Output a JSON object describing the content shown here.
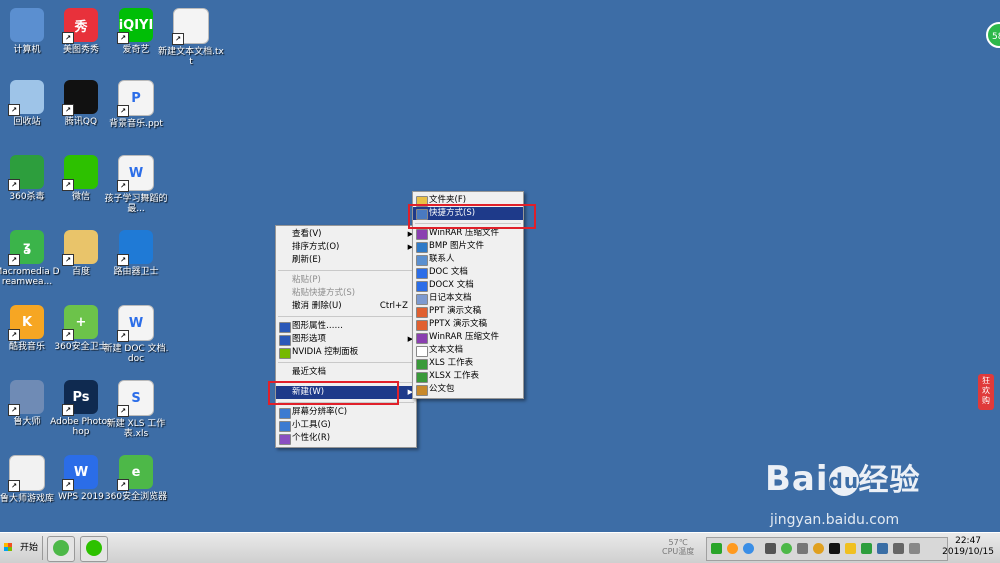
{
  "desktop_icons": [
    {
      "label": "计算机",
      "color": "#5b8fd0"
    },
    {
      "label": "美图秀秀",
      "color": "#e8313b",
      "glyph": "秀"
    },
    {
      "label": "爱奇艺",
      "color": "#00be06",
      "glyph": "iQIYI"
    },
    {
      "label": "新建文本文档.txt",
      "color": "#f4f4f4"
    },
    {
      "label": "回收站",
      "color": "#9ec4e8"
    },
    {
      "label": "腾讯QQ",
      "color": "#111111"
    },
    {
      "label": "背景音乐.ppt",
      "color": "#f4f4f4",
      "glyph": "P"
    },
    {
      "label": "360杀毒",
      "color": "#2d9e3d"
    },
    {
      "label": "微信",
      "color": "#2dc100"
    },
    {
      "label": "孩子学习舞蹈的最...",
      "color": "#f4f4f4",
      "glyph": "W"
    },
    {
      "label": "Macromedia Dreamwea...",
      "color": "#3bb44a",
      "glyph": "ʓ"
    },
    {
      "label": "百度",
      "color": "#e9c46a"
    },
    {
      "label": "路由器卫士",
      "color": "#1f7ad6"
    },
    {
      "label": "酷我音乐",
      "color": "#f6a623",
      "glyph": "K"
    },
    {
      "label": "360安全卫士",
      "color": "#6cc34a",
      "glyph": "+"
    },
    {
      "label": "新建 DOC 文档.doc",
      "color": "#f4f4f4",
      "glyph": "W"
    },
    {
      "label": "鲁大师",
      "color": "#6f8bb5"
    },
    {
      "label": "Adobe Photoshop",
      "color": "#0f2a50",
      "glyph": "Ps"
    },
    {
      "label": "新建 XLS 工作表.xls",
      "color": "#f4f4f4",
      "glyph": "S"
    },
    {
      "label": "鲁大师游戏库",
      "color": "#f2f2f2"
    },
    {
      "label": "WPS 2019",
      "color": "#2b6de8",
      "glyph": "W"
    },
    {
      "label": "360安全浏览器",
      "color": "#4db848",
      "glyph": "e"
    }
  ],
  "context_menu": {
    "items": [
      {
        "label": "查看(V)",
        "sub": "▶"
      },
      {
        "label": "排序方式(O)",
        "sub": "▶"
      },
      {
        "label": "刷新(E)"
      },
      {
        "sep": true
      },
      {
        "label": "粘贴(P)",
        "disabled": true
      },
      {
        "label": "粘贴快捷方式(S)",
        "disabled": true
      },
      {
        "label": "撤消 删除(U)",
        "shortcut": "Ctrl+Z"
      },
      {
        "sep": true
      },
      {
        "label": "图形属性……",
        "icon": "#2a58b8"
      },
      {
        "label": "图形选项",
        "icon": "#2a58b8",
        "sub": "▶"
      },
      {
        "label": "NVIDIA 控制面板",
        "icon": "#76b900"
      },
      {
        "sep": true
      },
      {
        "label": "最近文档"
      },
      {
        "sep": true
      },
      {
        "label": "新建(W)",
        "sub": "▶",
        "highlight": true
      },
      {
        "sep": true
      },
      {
        "label": "屏幕分辨率(C)",
        "icon": "#3d7bd1"
      },
      {
        "label": "小工具(G)",
        "icon": "#3d7bd1"
      },
      {
        "label": "个性化(R)",
        "icon": "#8a4fc1"
      }
    ]
  },
  "new_submenu": {
    "items": [
      {
        "label": "文件夹(F)",
        "icon": "#e9c046"
      },
      {
        "label": "快捷方式(S)",
        "icon": "#4a7ac0",
        "highlight": true
      },
      {
        "sep": true
      },
      {
        "label": "WinRAR 压缩文件",
        "icon": "#8a3fb0"
      },
      {
        "label": "BMP 图片文件",
        "icon": "#2f7ac8"
      },
      {
        "label": "联系人",
        "icon": "#5a8fd0"
      },
      {
        "label": "DOC 文档",
        "icon": "#2b6de8"
      },
      {
        "label": "DOCX 文档",
        "icon": "#2b6de8"
      },
      {
        "label": "日记本文档",
        "icon": "#7d9ad0"
      },
      {
        "label": "PPT 演示文稿",
        "icon": "#e06030"
      },
      {
        "label": "PPTX 演示文稿",
        "icon": "#e06030"
      },
      {
        "label": "WinRAR 压缩文件",
        "icon": "#8a3fb0"
      },
      {
        "label": "文本文档",
        "icon": "#ffffff"
      },
      {
        "label": "XLS 工作表",
        "icon": "#3a9a3a"
      },
      {
        "label": "XLSX 工作表",
        "icon": "#3a9a3a"
      },
      {
        "label": "公文包",
        "icon": "#c8892b"
      }
    ]
  },
  "taskbar": {
    "start_label": "开始",
    "weather_temp": "57℃",
    "weather_label": "CPU温度",
    "clock_time": "22:47",
    "clock_date": "2019/10/15"
  },
  "watermark": {
    "brand": "Bai",
    "brand_cn": "经验",
    "url": "jingyan.baidu.com"
  },
  "side_widgets": {
    "top_right_badge": "58",
    "side_tab": "狂欢购"
  },
  "colors": {
    "desktop_bg": "#3d6da6",
    "highlight": "#1e3a8a",
    "annotation_red": "#e0202a"
  }
}
